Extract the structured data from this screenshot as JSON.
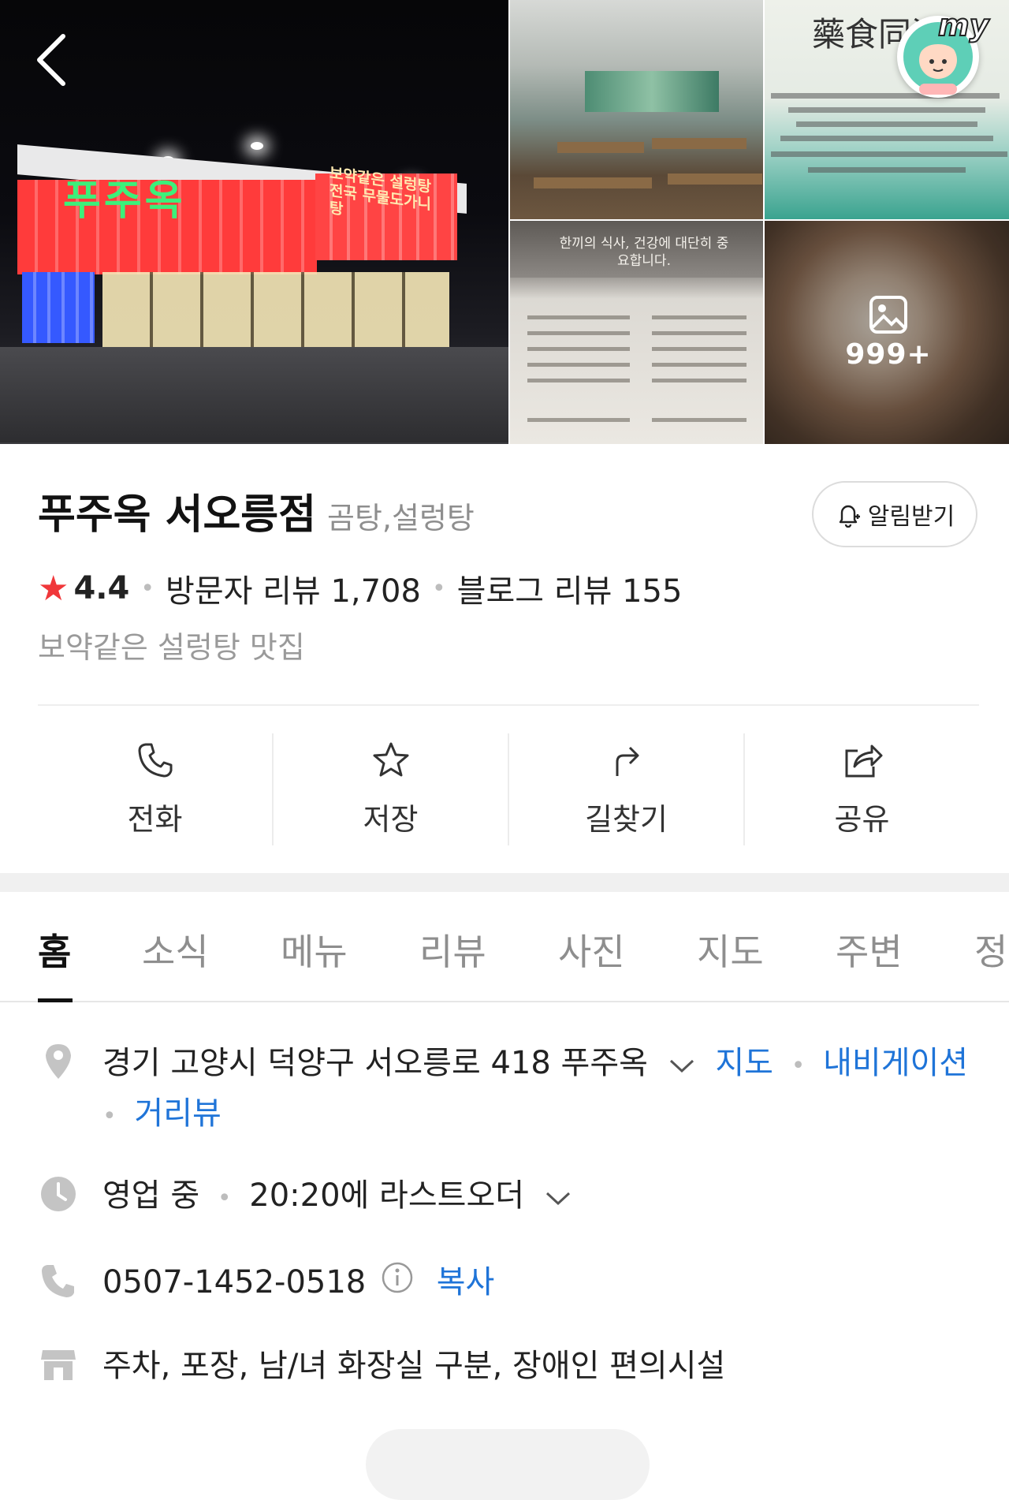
{
  "photos": {
    "main_sign_text": "푸주옥",
    "main_slogan": "보약같은 설렁탕 전국 무물도가니탕",
    "menu_header": "한끼의 식사, 건강에 대단히 중요합니다.",
    "sign_hanja": "藥食同源",
    "more_count": "999+"
  },
  "my_badge": {
    "label": "my"
  },
  "place": {
    "name": "푸주옥 서오릉점",
    "category": "곰탕,설렁탕",
    "notify_label": "알림받기",
    "rating": "4.4",
    "visitor_reviews": "방문자 리뷰 1,708",
    "blog_reviews": "블로그 리뷰 155",
    "tagline": "보약같은 설렁탕 맛집"
  },
  "actions": [
    {
      "label": "전화",
      "icon": "phone-icon"
    },
    {
      "label": "저장",
      "icon": "star-icon"
    },
    {
      "label": "길찾기",
      "icon": "directions-icon"
    },
    {
      "label": "공유",
      "icon": "share-icon"
    }
  ],
  "tabs": [
    "홈",
    "소식",
    "메뉴",
    "리뷰",
    "사진",
    "지도",
    "주변",
    "정보"
  ],
  "details": {
    "address": "경기 고양시 덕양구 서오릉로 418 푸주옥",
    "map_link": "지도",
    "nav_link": "내비게이션",
    "street_link": "거리뷰",
    "status": "영업 중",
    "last_order": "20:20에 라스트오더",
    "phone": "0507-1452-0518",
    "copy_label": "복사",
    "amenities": "주차, 포장, 남/녀 화장실 구분, 장애인 편의시설"
  },
  "colors": {
    "accent_link": "#1f74d8",
    "star": "#f0373a"
  }
}
